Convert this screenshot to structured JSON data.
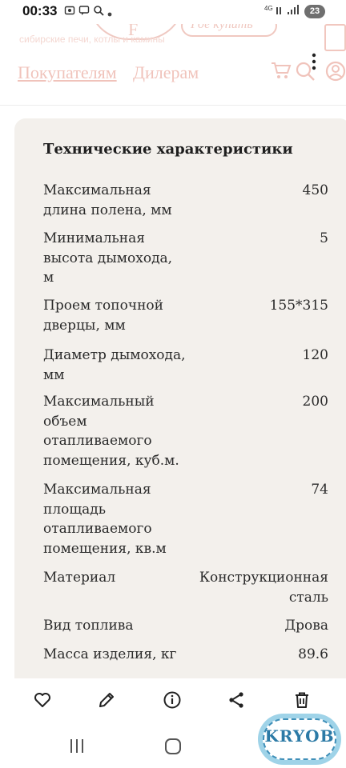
{
  "status_bar": {
    "time": "00:33",
    "net_label": "4G",
    "battery": "23",
    "icons": [
      "screenshot-icon",
      "message-icon",
      "search-icon",
      "signal-icon",
      "battery-icon"
    ]
  },
  "site_header": {
    "logo_letter": "F",
    "buy_label": "Где купить",
    "tagline": "сибирские печи, котлы и камины",
    "nav": {
      "buyers": "Покупателям",
      "dealers": "Дилерам"
    },
    "icons": [
      "calculator-icon",
      "cart-icon",
      "search-icon",
      "user-icon",
      "more-vertical-icon"
    ]
  },
  "specs": {
    "title": "Технические характеристики",
    "rows": [
      {
        "label": "Максимальная\nдлина полена, мм",
        "value": "450"
      },
      {
        "label": "Минимальная\nвысота дымохода,\nм",
        "value": "5"
      },
      {
        "label": "Проем топочной\nдверцы, мм",
        "value": "155*315"
      },
      {
        "label": "Диаметр дымохода,\nмм",
        "value": "120"
      },
      {
        "label": "Максимальный\nобъем\nотапливаемого\nпомещения, куб.м.",
        "value": "200"
      },
      {
        "label": "Максимальная\nплощадь\nотапливаемого\nпомещения, кв.м",
        "value": "74"
      },
      {
        "label": "Материал",
        "value": "Конструкционная\nсталь"
      },
      {
        "label": "Вид топлива",
        "value": "Дрова"
      },
      {
        "label": "Масса изделия, кг",
        "value": "89.6"
      }
    ]
  },
  "action_bar": {
    "items": [
      "favorite-icon",
      "edit-icon",
      "info-icon",
      "share-icon",
      "delete-icon"
    ]
  },
  "system_nav": {
    "items": [
      "recent-apps-icon",
      "home-icon"
    ]
  },
  "watermark": {
    "text": "KRYOB"
  },
  "colors": {
    "card_bg": "#f3f0ec",
    "faded_header": "#f0c3bb",
    "watermark_blue": "#2c7aa6"
  }
}
